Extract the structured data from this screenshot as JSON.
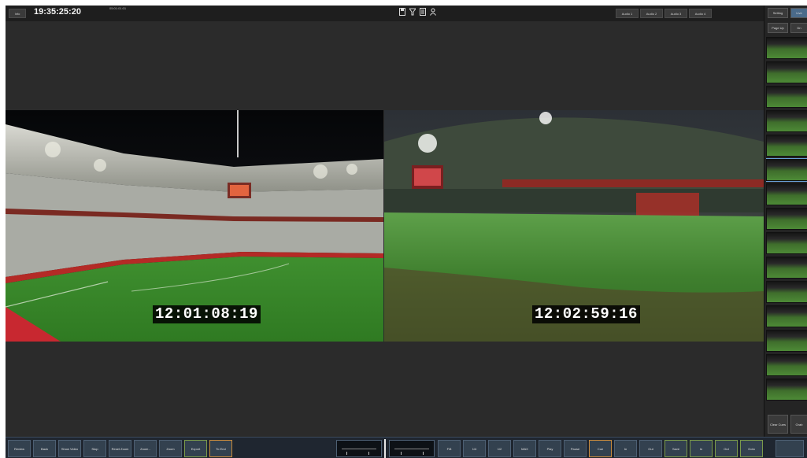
{
  "topbar": {
    "menu_label": "Info",
    "clock": "19:35:25:20",
    "sub_clock": "05:01:01:01",
    "center_icons": [
      "save-icon",
      "filter-icon",
      "list-icon",
      "user-icon"
    ],
    "audio_buttons": [
      "Audio 1",
      "Audio 2",
      "Audio 3",
      "Audio 4"
    ]
  },
  "right_panel": {
    "setting_label": "Setting",
    "tab2_label": "Live",
    "page_up_label": "Page Up",
    "page_down_label": "Dn",
    "clear_label": "Clear Cues",
    "grab_label": "Grab"
  },
  "video": {
    "left_timecode": "12:01:08:19",
    "right_timecode": "12:02:59:16"
  },
  "toolbar": {
    "buttons": [
      {
        "id": "review",
        "label": "Review"
      },
      {
        "id": "back",
        "label": "Back"
      },
      {
        "id": "show-video",
        "label": "Show Video"
      },
      {
        "id": "stop",
        "label": "Stop"
      },
      {
        "id": "reset-zoom",
        "label": "Reset Zoom"
      },
      {
        "id": "zoom-minus",
        "label": "Zoom -"
      },
      {
        "id": "zoom-plus",
        "label": "Zoom"
      },
      {
        "id": "export",
        "label": "Export"
      },
      {
        "id": "to-end",
        "label": "To End"
      },
      {
        "id": "f8",
        "label": "F/8"
      },
      {
        "id": "f4",
        "label": "1/4"
      },
      {
        "id": "f2",
        "label": "1/2"
      },
      {
        "id": "play",
        "label": "MAX"
      },
      {
        "id": "play2",
        "label": "Play"
      },
      {
        "id": "pause",
        "label": "Pause"
      },
      {
        "id": "cue",
        "label": "Cue"
      },
      {
        "id": "in",
        "label": "In"
      },
      {
        "id": "out",
        "label": "Out"
      },
      {
        "id": "save",
        "label": "Save"
      },
      {
        "id": "mark-in",
        "label": "In"
      },
      {
        "id": "mark-out",
        "label": "Out"
      },
      {
        "id": "goto",
        "label": "Goto"
      }
    ]
  },
  "colors": {
    "app_bg": "#2b2b2b",
    "toolbar_bg": "#1f2630",
    "accent_orange": "#c98b3c",
    "accent_green": "#7a9a4a",
    "accent_blue": "#4a6a8a"
  }
}
